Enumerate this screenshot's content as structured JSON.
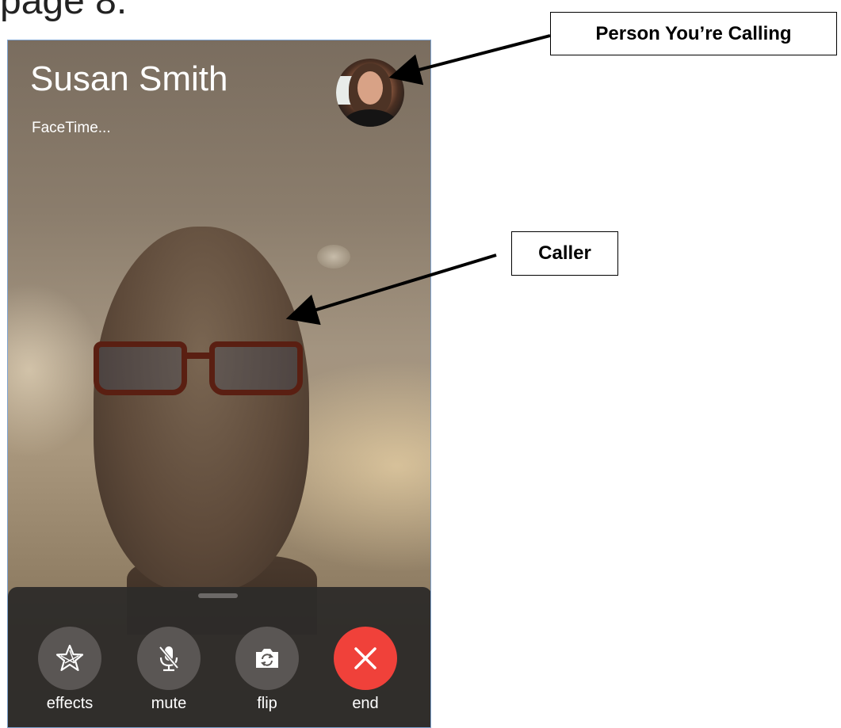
{
  "page": {
    "heading": "page 8."
  },
  "call": {
    "contact_name": "Susan Smith",
    "status": "FaceTime..."
  },
  "controls": {
    "effects_label": "effects",
    "mute_label": "mute",
    "flip_label": "flip",
    "end_label": "end"
  },
  "annotations": {
    "person_label": "Person You’re Calling",
    "caller_label": "Caller"
  },
  "colors": {
    "end_button": "#f0413a",
    "control_button": "#5a5654",
    "panel": "#2e2c2a"
  },
  "icons": {
    "effects": "star-icon",
    "mute": "microphone-slash-icon",
    "flip": "camera-flip-icon",
    "end": "close-icon"
  }
}
